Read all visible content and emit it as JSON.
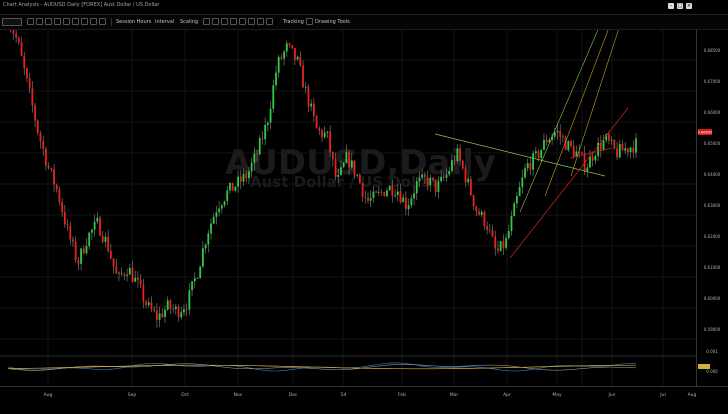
{
  "window": {
    "title": "Chart Analysis - AUDUSD Daily [FOREX] Aust Dollar / US Dollar"
  },
  "toolbar": {
    "session_hours": "Session Hours",
    "interval": "Interval",
    "scaling": "Scaling",
    "tracking": "Tracking",
    "drawing_tools": "Drawing Tools"
  },
  "watermark": {
    "symbol": "AUDUSD,Daily",
    "description": "Aust Dollar / US Dollar"
  },
  "chart_data": {
    "type": "candlestick",
    "x_labels": [
      "Aug",
      "Sep",
      "Oct",
      "Nov",
      "Dec",
      "'24",
      "Feb",
      "Mar",
      "Apr",
      "May",
      "Jun",
      "Jul",
      "Aug"
    ],
    "y_ticks": [
      "0.68500",
      "0.67000",
      "0.66000",
      "0.65000",
      "0.64000",
      "0.63000",
      "0.62000",
      "0.61000",
      "0.60000",
      "0.59000"
    ],
    "ylim": [
      0.627,
      0.693
    ],
    "last_price": "0.66600",
    "close_path": [
      0.696,
      0.69,
      0.68,
      0.67,
      0.662,
      0.656,
      0.647,
      0.64,
      0.646,
      0.649,
      0.644,
      0.636,
      0.639,
      0.635,
      0.63,
      0.6275,
      0.63,
      0.629,
      0.631,
      0.638,
      0.647,
      0.653,
      0.656,
      0.658,
      0.66,
      0.665,
      0.672,
      0.685,
      0.689,
      0.686,
      0.678,
      0.67,
      0.669,
      0.658,
      0.664,
      0.66,
      0.654,
      0.655,
      0.657,
      0.657,
      0.653,
      0.658,
      0.659,
      0.657,
      0.66,
      0.665,
      0.659,
      0.652,
      0.649,
      0.642,
      0.645,
      0.654,
      0.662,
      0.664,
      0.668,
      0.67,
      0.667,
      0.665,
      0.662,
      0.666,
      0.668,
      0.665,
      0.666,
      0.667
    ],
    "indicator_ticks": [
      "0.001",
      "0.000"
    ]
  }
}
